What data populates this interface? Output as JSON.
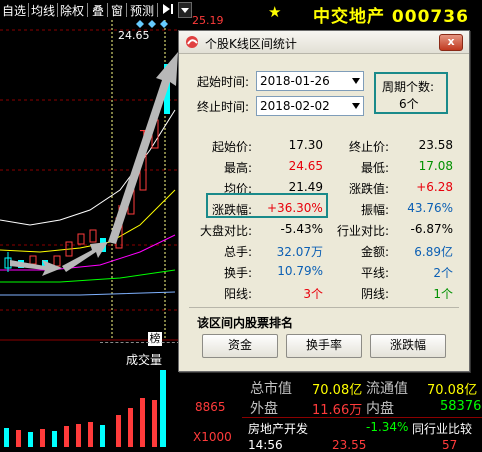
{
  "toolbar": {
    "items": [
      "自选",
      "均线",
      "除权",
      "叠",
      "窗",
      "预测"
    ],
    "arrow_icon": "play-bar-icon"
  },
  "chart": {
    "price_right": "25.19",
    "price_top": "24.65",
    "badge": "榜",
    "volume_label": "成交量",
    "vol_value": "8865",
    "vol_scale": "X1000"
  },
  "stock": {
    "name": "中交地产",
    "code": "000736"
  },
  "dialog": {
    "title": "个股K线区间统计",
    "close_label": "x",
    "start_time_label": "起始时间:",
    "start_time_value": "2018-01-26",
    "end_time_label": "终止时间:",
    "end_time_value": "2018-02-02",
    "period_label": "周期个数:",
    "period_value": "6个",
    "stats": {
      "start_price_label": "起始价:",
      "start_price": "17.30",
      "end_price_label": "终止价:",
      "end_price": "23.58",
      "high_label": "最高:",
      "high": "24.65",
      "low_label": "最低:",
      "low": "17.08",
      "avg_label": "均价:",
      "avg": "21.49",
      "change_label": "涨跌值:",
      "change": "+6.28",
      "pct_label": "涨跌幅:",
      "pct": "+36.30%",
      "amp_label": "振幅:",
      "amp": "43.76%",
      "mkt_cmp_label": "大盘对比:",
      "mkt_cmp": "-5.43%",
      "ind_cmp_label": "行业对比:",
      "ind_cmp": "-6.87%",
      "volume_label": "总手:",
      "volume": "32.07万",
      "amount_label": "金额:",
      "amount": "6.89亿",
      "turnover_label": "换手:",
      "turnover": "10.79%",
      "flat_label": "平线:",
      "flat": "2个",
      "up_label": "阳线:",
      "up": "3个",
      "down_label": "阴线:",
      "down": "1个"
    },
    "rank_title": "该区间内股票排名",
    "buttons": [
      "资金",
      "换手率",
      "涨跌幅"
    ]
  },
  "right_panel": {
    "mkt_value_label": "总市值",
    "mkt_value": "70.08亿",
    "float_value_label": "流通值",
    "float_value": "70.08亿",
    "outer_label": "外盘",
    "outer_value": "11.66万",
    "inner_label": "内盘",
    "inner_value": "58376",
    "industry_label": "房地产开发",
    "industry_change": "-1.34%",
    "industry_cmp_label": "同行业比较",
    "bottom_time": "14:56",
    "bottom_price": "23.55",
    "bottom_vol": "57"
  },
  "colors": {
    "accent_teal": "#1a8a8a",
    "up_red": "#e8000b",
    "down_green": "#009100",
    "title_yellow": "#ffff00"
  }
}
